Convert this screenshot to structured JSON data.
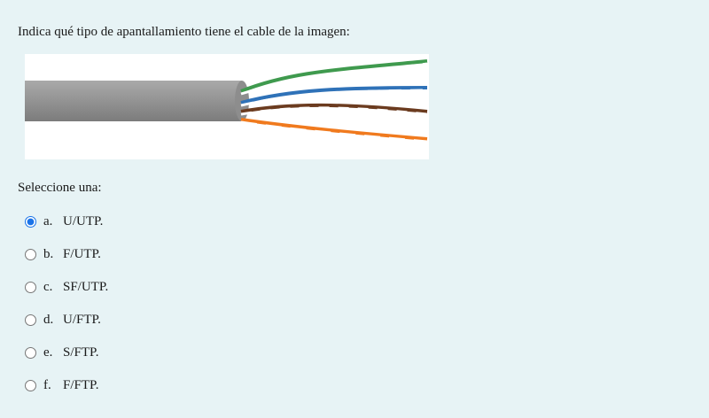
{
  "question": {
    "text": "Indica qué tipo de apantallamiento tiene el cable de la imagen:",
    "image": "cable-image"
  },
  "prompt": "Seleccione una:",
  "options": [
    {
      "letter": "a.",
      "label": "U/UTP.",
      "selected": true
    },
    {
      "letter": "b.",
      "label": "F/UTP.",
      "selected": false
    },
    {
      "letter": "c.",
      "label": "SF/UTP.",
      "selected": false
    },
    {
      "letter": "d.",
      "label": "U/FTP.",
      "selected": false
    },
    {
      "letter": "e.",
      "label": "S/FTP.",
      "selected": false
    },
    {
      "letter": "f.",
      "label": "F/FTP.",
      "selected": false
    }
  ],
  "colors": {
    "background": "#e7f3f5",
    "cable_jacket": "#8e8e8e",
    "pair_green": "#3f9a4e",
    "pair_blue": "#2f72b8",
    "pair_brown": "#6b3b1f",
    "pair_orange": "#f07a1e"
  }
}
